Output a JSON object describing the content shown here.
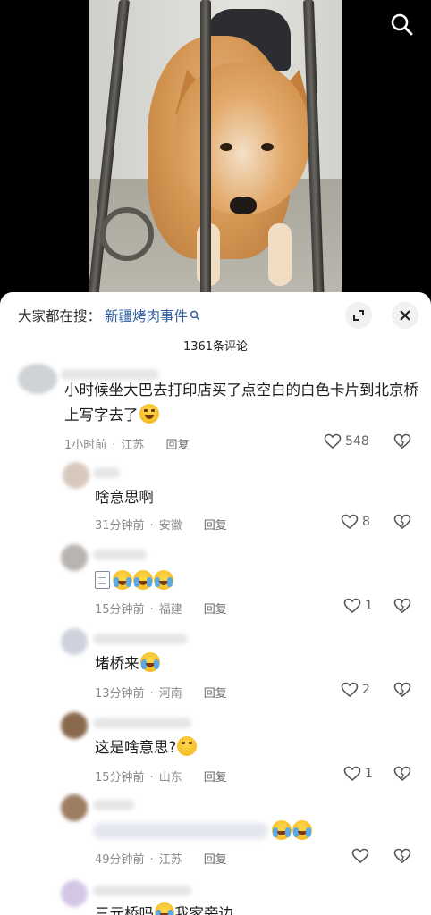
{
  "search_suggest": {
    "prefix": "大家都在搜：",
    "keyword": "新疆烤肉事件"
  },
  "comment_count": "1361条评论",
  "comments": [
    {
      "text": "小时候坐大巴去打印店买了点空白的白色卡片到北京桥上写字去了",
      "time": "1小时前",
      "location": "江苏",
      "reply": "回复",
      "likes": "548",
      "emoji": "grin"
    },
    {
      "text": "啥意思啊",
      "time": "31分钟前",
      "location": "安徽",
      "reply": "回复",
      "likes": "8"
    },
    {
      "text": "",
      "time": "15分钟前",
      "location": "福建",
      "reply": "回复",
      "likes": "1"
    },
    {
      "text": "堵桥来",
      "time": "13分钟前",
      "location": "河南",
      "reply": "回复",
      "likes": "2"
    },
    {
      "text": "这是啥意思?",
      "time": "15分钟前",
      "location": "山东",
      "reply": "回复",
      "likes": "1"
    },
    {
      "text": "",
      "time": "49分钟前",
      "location": "江苏",
      "reply": "回复",
      "likes": ""
    },
    {
      "text_a": "三元桥吗",
      "text_b": "我家旁边"
    }
  ],
  "colors": {
    "keyword": "#2f5f9e",
    "meta": "#8a8a8a",
    "sheet": "#ffffff"
  },
  "icons": [
    "search-icon",
    "expand-icon",
    "close-icon",
    "heart-icon",
    "broken-heart-icon"
  ]
}
